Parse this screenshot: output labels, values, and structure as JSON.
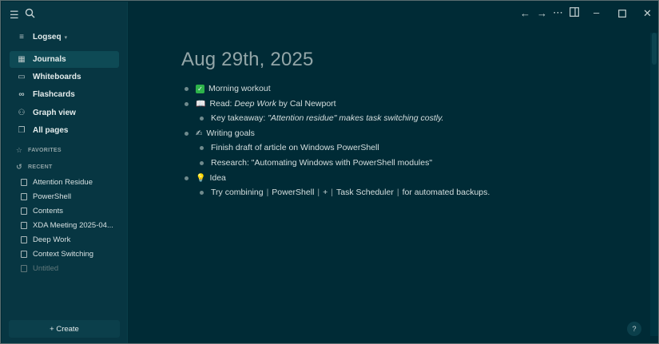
{
  "titlebar": {
    "menu_icon": "hamburger-icon",
    "search_icon": "search-icon",
    "back_icon": "arrow-left-icon",
    "forward_icon": "arrow-right-icon",
    "more_icon": "more-horizontal-icon",
    "sidebar_toggle_icon": "right-sidebar-icon",
    "minimize_icon": "minimize-icon",
    "maximize_icon": "maximize-icon",
    "close_icon": "close-icon"
  },
  "sidebar": {
    "graph_name": "Logseq",
    "nav": [
      {
        "label": "Journals",
        "icon": "calendar-icon",
        "active": true
      },
      {
        "label": "Whiteboards",
        "icon": "whiteboard-icon",
        "active": false
      },
      {
        "label": "Flashcards",
        "icon": "infinity-icon",
        "active": false
      },
      {
        "label": "Graph view",
        "icon": "graph-icon",
        "active": false
      },
      {
        "label": "All pages",
        "icon": "pages-icon",
        "active": false
      }
    ],
    "favorites_label": "FAVORITES",
    "recent_label": "RECENT",
    "recent": [
      "Attention Residue",
      "PowerShell",
      "Contents",
      "XDA Meeting 2025-04...",
      "Deep Work",
      "Context Switching",
      "Untitled"
    ],
    "create_label": "+ Create"
  },
  "journal": {
    "title": "Aug 29th, 2025",
    "blocks": {
      "b1": "Morning workout",
      "b2_pre": "Read: ",
      "b2_book": "Deep Work",
      "b2_post": " by Cal Newport",
      "b2_child_pre": "Key takeaway: ",
      "b2_child_quote": "\"Attention residue\" makes task switching costly.",
      "b3": "Writing goals",
      "b3_c1": "Finish draft of article on Windows PowerShell",
      "b3_c2": "Research: \"Automating Windows with PowerShell modules\"",
      "b4": "Idea",
      "b4_c1_pre": "Try combining",
      "b4_c1_ref1": "PowerShell",
      "b4_c1_plus": "+",
      "b4_c1_ref2": "Task Scheduler",
      "b4_c1_post": "for automated backups."
    }
  },
  "help_label": "?"
}
